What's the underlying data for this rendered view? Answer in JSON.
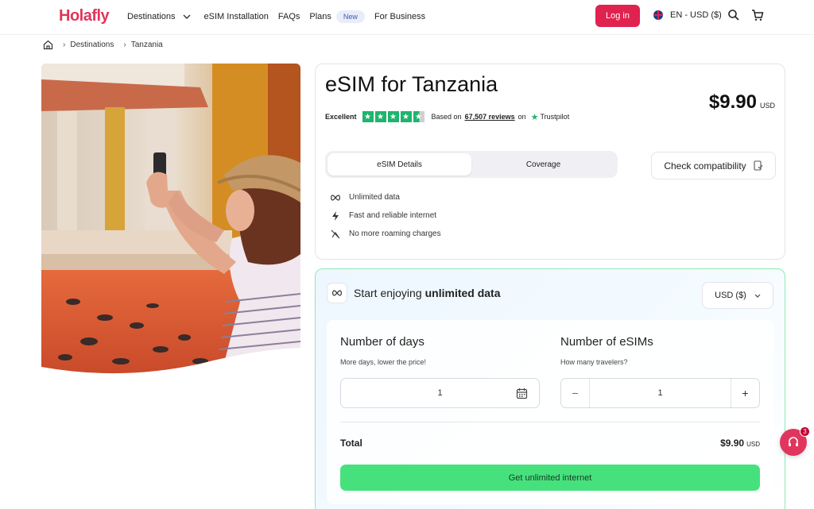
{
  "header": {
    "logo": "Holafly",
    "nav": {
      "destinations": "Destinations",
      "esim_installation": "eSIM Installation",
      "faqs": "FAQs",
      "plans": "Plans",
      "plans_badge": "New",
      "for_business": "For Business"
    },
    "login": "Log in",
    "language": "EN - USD ($)"
  },
  "breadcrumb": {
    "items": [
      "Destinations",
      "Tanzania"
    ]
  },
  "product": {
    "title": "eSIM for Tanzania",
    "rating_label": "Excellent",
    "rating_stars": 4.5,
    "reviews_prefix": "Based on",
    "reviews_count": "67,507 reviews",
    "reviews_suffix": "on",
    "trustpilot": "Trustpilot",
    "price": "$9.90",
    "price_currency": "USD",
    "tabs": [
      "eSIM Details",
      "Coverage"
    ],
    "check_compat": "Check compatibility",
    "features": [
      {
        "icon": "infinity-icon",
        "label": "Unlimited data"
      },
      {
        "icon": "lightning-icon",
        "label": "Fast and reliable internet"
      },
      {
        "icon": "no-roaming-icon",
        "label": "No more roaming charges"
      }
    ]
  },
  "plan": {
    "heading_prefix": "Start enjoying",
    "heading_bold": "unlimited data",
    "currency_select": "USD ($)",
    "days_title": "Number of days",
    "days_sub": "More days, lower the price!",
    "days_value": "1",
    "esims_title": "Number of eSIMs",
    "esims_sub": "How many travelers?",
    "esims_value": "1",
    "minus": "−",
    "plus": "+",
    "total_label": "Total",
    "total_amount": "$9.90",
    "total_currency": "USD",
    "cta": "Get unlimited internet"
  },
  "chat": {
    "unread": "3"
  },
  "colors": {
    "brand": "#e0365d",
    "cta_green": "#46e17d",
    "trustpilot_green": "#1fb46f"
  }
}
